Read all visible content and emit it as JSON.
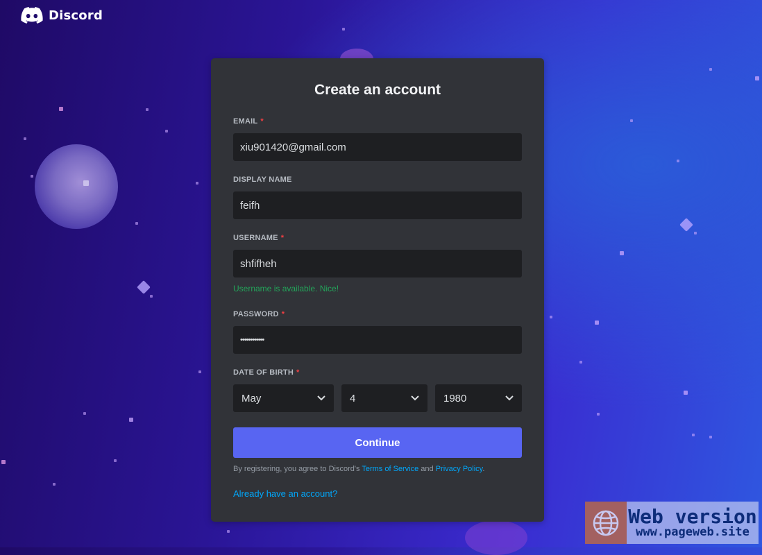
{
  "brand": {
    "name": "Discord"
  },
  "form": {
    "title": "Create an account",
    "email": {
      "label": "EMAIL",
      "required": true,
      "value": "xiu901420@gmail.com"
    },
    "display_name": {
      "label": "DISPLAY NAME",
      "value": "feifh"
    },
    "username": {
      "label": "USERNAME",
      "required": true,
      "value": "shfifheh",
      "status": "Username is available. Nice!"
    },
    "password": {
      "label": "PASSWORD",
      "required": true,
      "value": "••••••••••••"
    },
    "dob": {
      "label": "DATE OF BIRTH",
      "required": true,
      "month": "May",
      "day": "4",
      "year": "1980"
    },
    "required_marker": "*",
    "continue_label": "Continue",
    "legal": {
      "prefix": "By registering, you agree to Discord's ",
      "terms": "Terms of Service",
      "and": " and ",
      "privacy": "Privacy Policy",
      "suffix": "."
    },
    "login_link": "Already have an account?"
  },
  "watermark": {
    "title": "Web version",
    "url": "www.pageweb.site"
  },
  "colors": {
    "accent": "#5865f2",
    "card": "#313338",
    "input": "#1e1f22",
    "link": "#00a8fc",
    "success": "#23a55a",
    "required": "#f23f43"
  }
}
